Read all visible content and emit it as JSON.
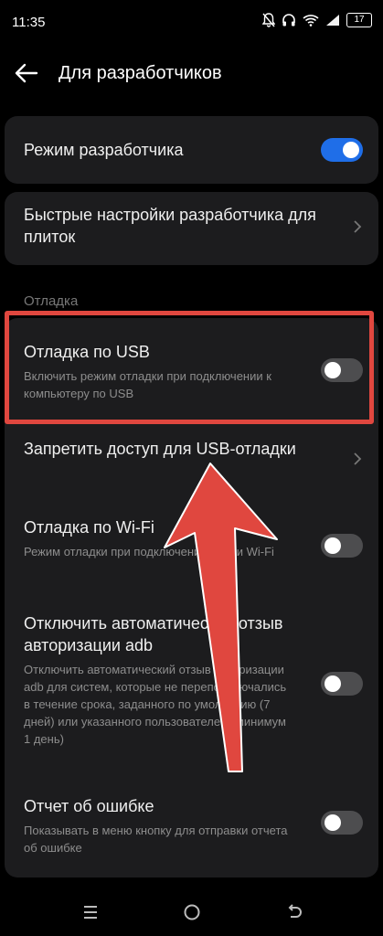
{
  "status_bar": {
    "time": "11:35",
    "battery": "17"
  },
  "header": {
    "title": "Для разработчиков"
  },
  "dev_mode": {
    "label": "Режим разработчика",
    "enabled": true
  },
  "quick_settings": {
    "label": "Быстрые настройки разработчика для плиток"
  },
  "section": {
    "label": "Отладка"
  },
  "usb_debug": {
    "title": "Отладка по USB",
    "subtitle": "Включить режим отладки при подключении к компьютеру по USB",
    "enabled": false
  },
  "revoke_usb": {
    "title": "Запретить доступ для USB-отладки"
  },
  "wifi_debug": {
    "title": "Отладка по Wi-Fi",
    "subtitle": "Режим отладки при подключении к сети Wi-Fi",
    "enabled": false
  },
  "adb_revoke": {
    "title": "Отключить автоматический отзыв авторизации adb",
    "subtitle": "Отключить автоматический отзыв авторизации adb для систем, которые не переподключались в течение срока, заданного по умолчанию (7 дней) или указанного пользователем (минимум 1 день)",
    "enabled": false
  },
  "bug_report": {
    "title": "Отчет об ошибке",
    "subtitle": "Показывать в меню кнопку для отправки отчета об ошибке",
    "enabled": false
  },
  "colors": {
    "accent": "#1f6ee8",
    "highlight": "#e0473f"
  },
  "icons": {
    "back": "arrow-left-icon",
    "chevron": "chevron-right-icon",
    "nav_menu": "menu-icon",
    "nav_home": "home-icon",
    "nav_back": "back-icon"
  }
}
